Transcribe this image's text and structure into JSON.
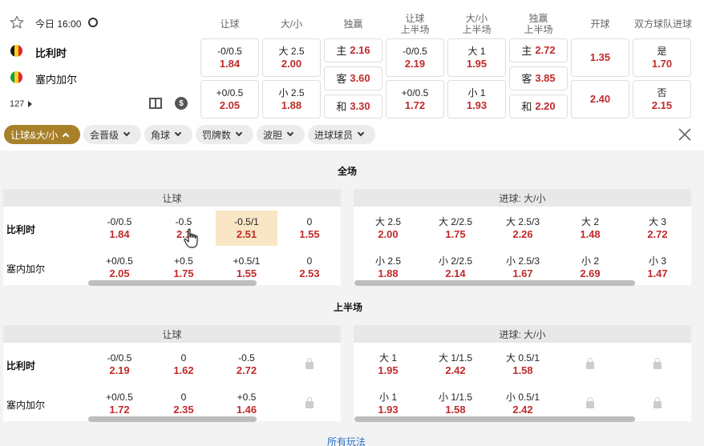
{
  "match": {
    "date_label": "今日 16:00",
    "home": "比利时",
    "away": "塞内加尔",
    "market_count": "127",
    "home_flag": [
      "#1a1a1a",
      "#f6d21a",
      "#e0262b"
    ],
    "away_flag": [
      "#15a045",
      "#f6d21a",
      "#e0262b"
    ]
  },
  "top_columns": [
    {
      "key": "hcp",
      "label": "让球"
    },
    {
      "key": "ou",
      "label": "大/小"
    },
    {
      "key": "1x2",
      "label": "独赢"
    },
    {
      "key": "hcp_1h",
      "label": "让球\n上半场"
    },
    {
      "key": "ou_1h",
      "label": "大/小\n上半场"
    },
    {
      "key": "1x2_1h",
      "label": "独赢\n上半场"
    },
    {
      "key": "ko",
      "label": "开球"
    },
    {
      "key": "btts",
      "label": "双方球队进球"
    }
  ],
  "top_odds": {
    "hcp": [
      {
        "line": "-0/0.5",
        "odds": "1.84"
      },
      {
        "line": "+0/0.5",
        "odds": "2.05"
      }
    ],
    "ou": [
      {
        "line": "大 2.5",
        "odds": "2.00"
      },
      {
        "line": "小 2.5",
        "odds": "1.88"
      }
    ],
    "x12": [
      {
        "line": "主",
        "odds": "2.16"
      },
      {
        "line": "客",
        "odds": "3.60"
      },
      {
        "line": "和",
        "odds": "3.30"
      }
    ],
    "hcp_1h": [
      {
        "line": "-0/0.5",
        "odds": "2.19"
      },
      {
        "line": "+0/0.5",
        "odds": "1.72"
      }
    ],
    "ou_1h": [
      {
        "line": "大 1",
        "odds": "1.95"
      },
      {
        "line": "小 1",
        "odds": "1.93"
      }
    ],
    "x12_1h": [
      {
        "line": "主",
        "odds": "2.72"
      },
      {
        "line": "客",
        "odds": "3.85"
      },
      {
        "line": "和",
        "odds": "2.20"
      }
    ],
    "ko": [
      {
        "odds": "1.35"
      },
      {
        "odds": "2.40"
      }
    ],
    "btts": [
      {
        "line": "是",
        "odds": "1.70"
      },
      {
        "line": "否",
        "odds": "2.15"
      }
    ]
  },
  "filters": [
    "让球&大/小",
    "会晋级",
    "角球",
    "罚牌数",
    "波胆",
    "进球球员"
  ],
  "full": {
    "title": "全场",
    "hcp_title": "让球",
    "ou_title": "进球: 大/小",
    "hcp": [
      [
        {
          "line": "-0/0.5",
          "odds": "1.84"
        },
        {
          "line": "-0.5",
          "odds": "2.1"
        },
        {
          "line": "-0.5/1",
          "odds": "2.51"
        },
        {
          "line": "0",
          "odds": "1.55"
        }
      ],
      [
        {
          "line": "+0/0.5",
          "odds": "2.05"
        },
        {
          "line": "+0.5",
          "odds": "1.75"
        },
        {
          "line": "+0.5/1",
          "odds": "1.55"
        },
        {
          "line": "0",
          "odds": "2.53"
        }
      ]
    ],
    "ou": [
      [
        {
          "line": "大 2.5",
          "odds": "2.00"
        },
        {
          "line": "大 2/2.5",
          "odds": "1.75"
        },
        {
          "line": "大 2.5/3",
          "odds": "2.26"
        },
        {
          "line": "大 2",
          "odds": "1.48"
        },
        {
          "line": "大 3",
          "odds": "2.72"
        }
      ],
      [
        {
          "line": "小 2.5",
          "odds": "1.88"
        },
        {
          "line": "小 2/2.5",
          "odds": "2.14"
        },
        {
          "line": "小 2.5/3",
          "odds": "1.67"
        },
        {
          "line": "小 2",
          "odds": "2.69"
        },
        {
          "line": "小 3",
          "odds": "1.47"
        }
      ]
    ]
  },
  "half": {
    "title": "上半场",
    "hcp_title": "让球",
    "ou_title": "进球: 大/小",
    "hcp": [
      [
        {
          "line": "-0/0.5",
          "odds": "2.19"
        },
        {
          "line": "0",
          "odds": "1.62"
        },
        {
          "line": "-0.5",
          "odds": "2.72"
        }
      ],
      [
        {
          "line": "+0/0.5",
          "odds": "1.72"
        },
        {
          "line": "0",
          "odds": "2.35"
        },
        {
          "line": "+0.5",
          "odds": "1.46"
        }
      ]
    ],
    "ou": [
      [
        {
          "line": "大 1",
          "odds": "1.95"
        },
        {
          "line": "大 1/1.5",
          "odds": "2.42"
        },
        {
          "line": "大 0.5/1",
          "odds": "1.58"
        }
      ],
      [
        {
          "line": "小 1",
          "odds": "1.93"
        },
        {
          "line": "小 1/1.5",
          "odds": "1.58"
        },
        {
          "line": "小 0.5/1",
          "odds": "2.42"
        }
      ]
    ]
  },
  "footer": {
    "more_label": "所有玩法"
  }
}
